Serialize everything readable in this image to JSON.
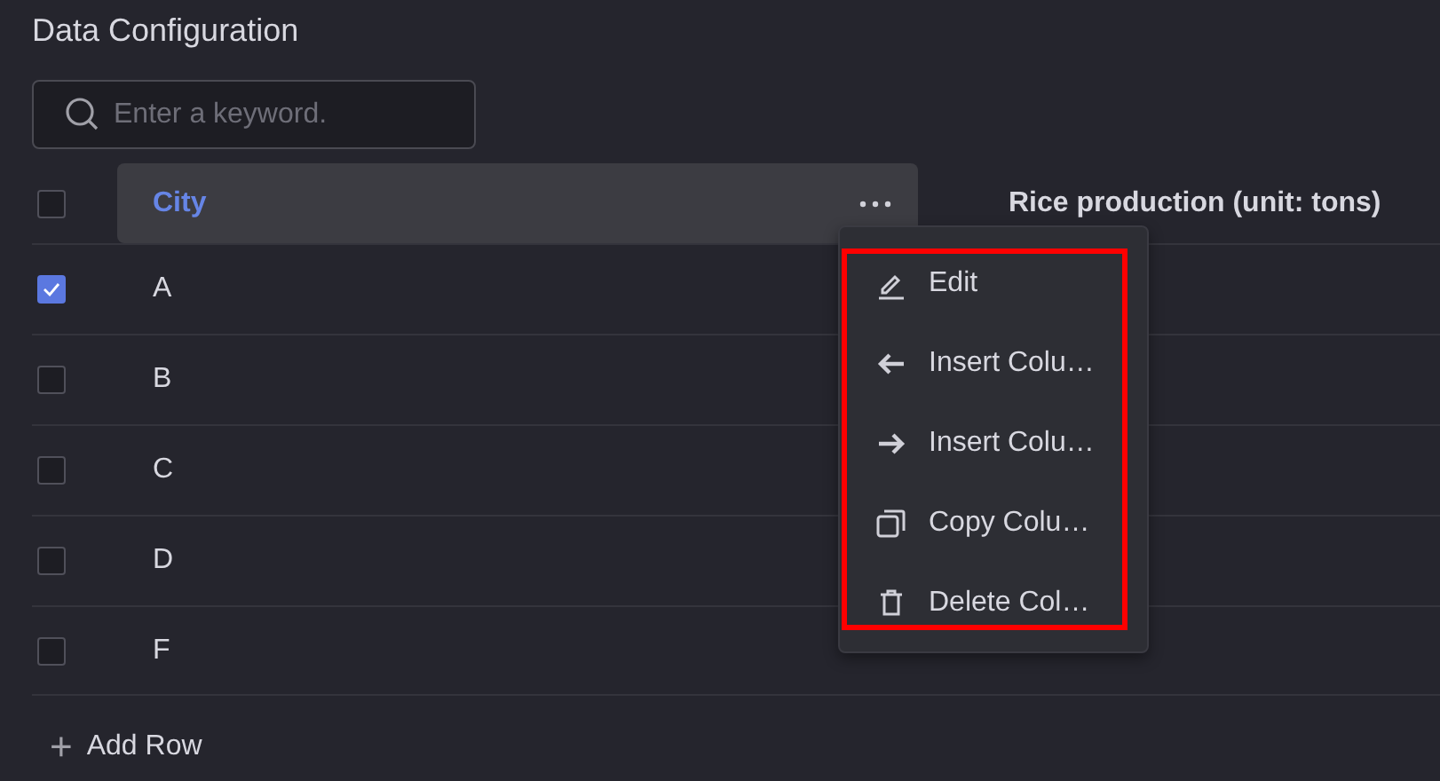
{
  "title": "Data Configuration",
  "search": {
    "placeholder": "Enter a keyword."
  },
  "header": {
    "checked": false,
    "columns": [
      {
        "label": "City",
        "selected": true
      },
      {
        "label": "Rice production (unit: tons)",
        "selected": false
      }
    ]
  },
  "rows": [
    {
      "city": "A",
      "checked": true
    },
    {
      "city": "B",
      "checked": false
    },
    {
      "city": "C",
      "checked": false
    },
    {
      "city": "D",
      "checked": false
    },
    {
      "city": "F",
      "checked": false
    }
  ],
  "add_row": {
    "icon": "+",
    "label": "Add Row"
  },
  "column_menu": {
    "highlighted": true,
    "items": [
      {
        "kind": "edit",
        "label": "Edit"
      },
      {
        "kind": "insert-left",
        "label": "Insert Colu…"
      },
      {
        "kind": "insert-right",
        "label": "Insert Colu…"
      },
      {
        "kind": "copy",
        "label": "Copy Colu…"
      },
      {
        "kind": "delete",
        "label": "Delete Col…"
      }
    ]
  }
}
